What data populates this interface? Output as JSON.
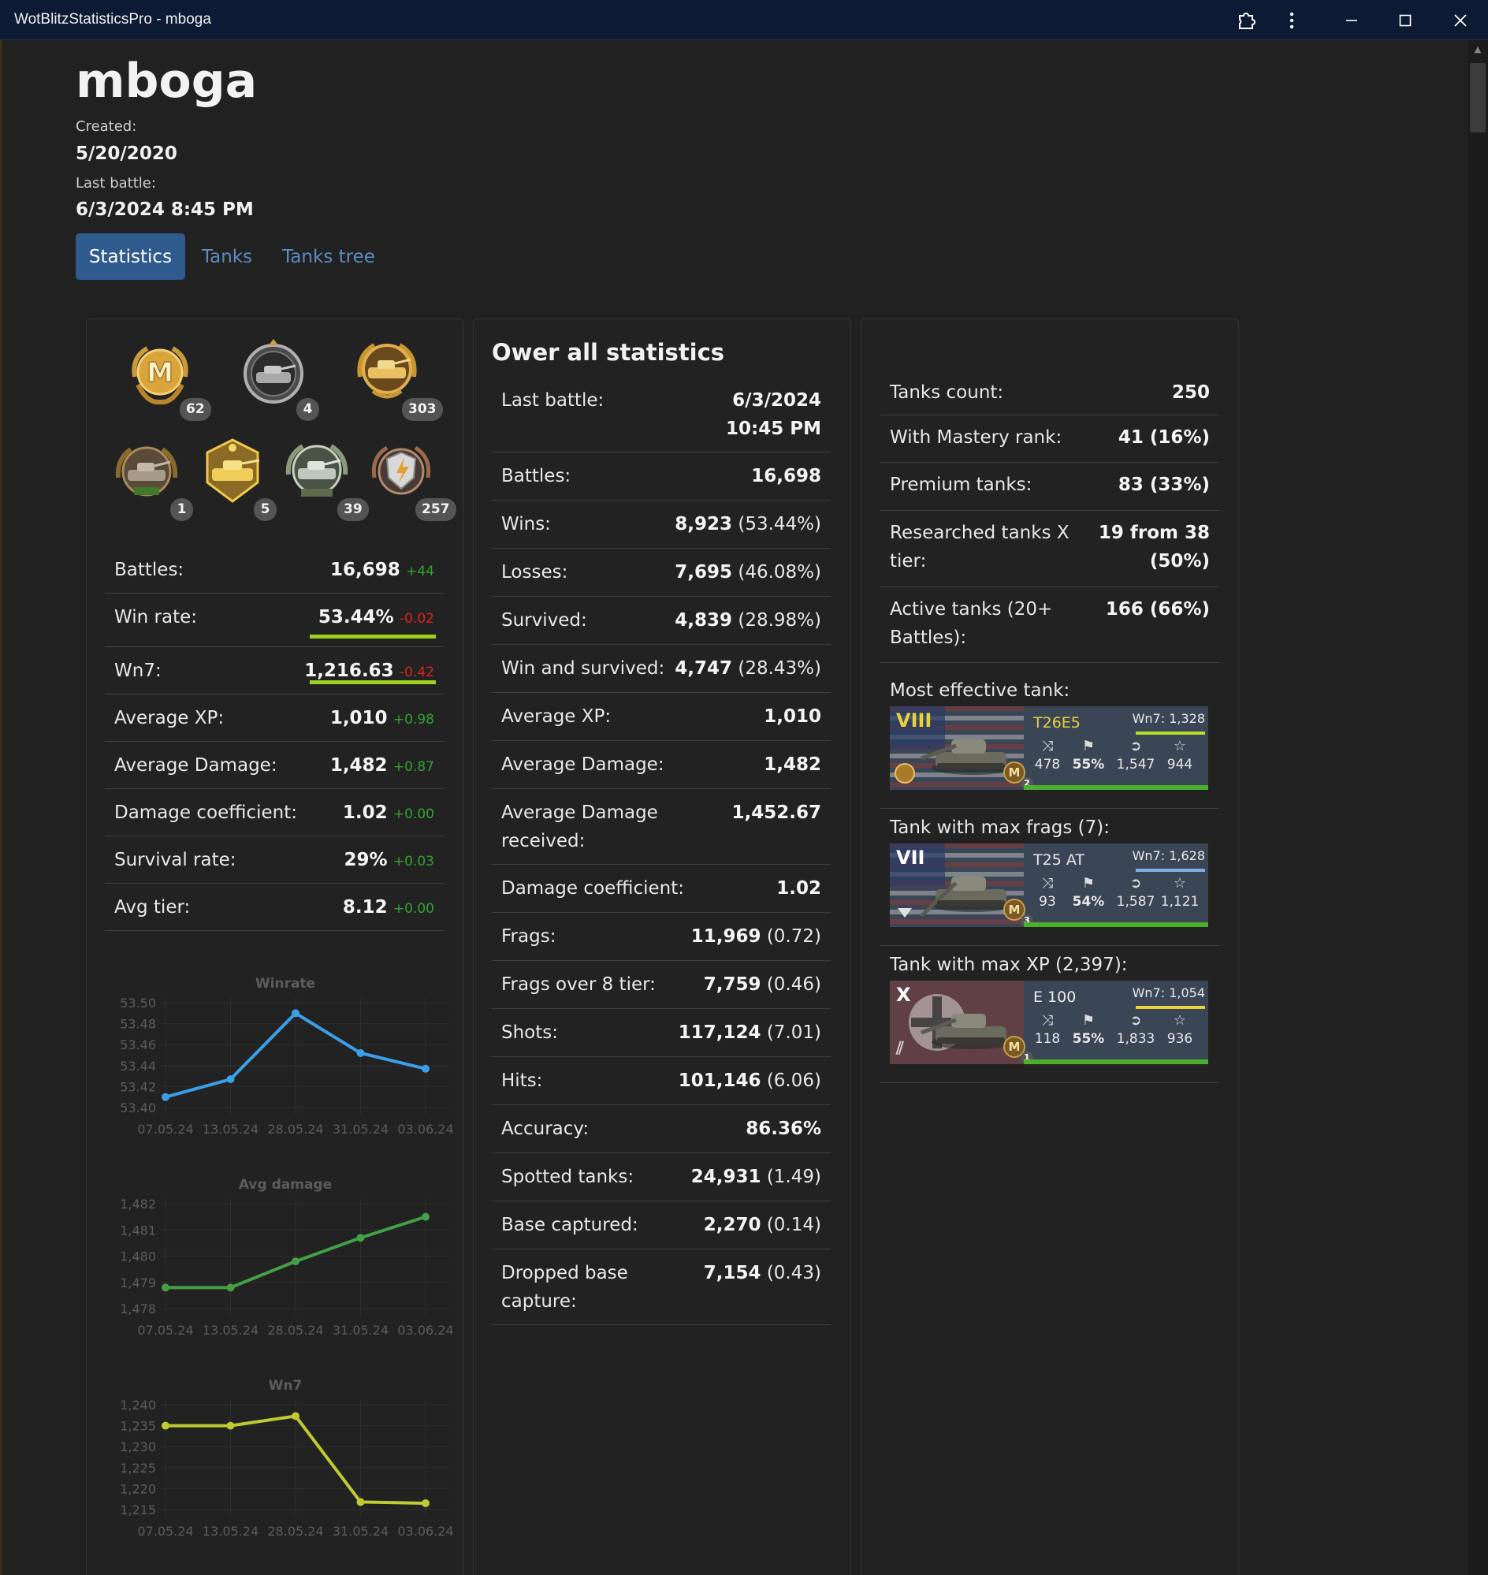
{
  "window": {
    "title": "WotBlitzStatisticsPro - mboga"
  },
  "player": {
    "name": "mboga",
    "created_label": "Created:",
    "created_value": "5/20/2020",
    "last_battle_label": "Last battle:",
    "last_battle_value": "6/3/2024 8:45 PM"
  },
  "tabs": [
    {
      "label": "Statistics",
      "active": true
    },
    {
      "label": "Tanks",
      "active": false
    },
    {
      "label": "Tanks tree",
      "active": false
    }
  ],
  "medals": [
    {
      "icon": "mastery-ace-icon",
      "count": "62"
    },
    {
      "icon": "tank-medal-icon",
      "count": "4"
    },
    {
      "icon": "gold-tank-medal-icon",
      "count": "303"
    },
    {
      "icon": "bronze-tank-medal-icon",
      "count": "1"
    },
    {
      "icon": "gold-tank-badge-icon",
      "count": "5"
    },
    {
      "icon": "silver-tank-badge-icon",
      "count": "39"
    },
    {
      "icon": "shield-lightning-medal-icon",
      "count": "257"
    }
  ],
  "left_stats": [
    {
      "label": "Battles:",
      "value": "16,698",
      "delta": "+44",
      "delta_sign": "pos"
    },
    {
      "label": "Win rate:",
      "value": "53.44%",
      "delta": "-0.02",
      "delta_sign": "neg",
      "underline": true
    },
    {
      "label": "Wn7:",
      "value": "1,216.63",
      "delta": "-0.42",
      "delta_sign": "neg",
      "underline": true
    },
    {
      "label": "Average XP:",
      "value": "1,010",
      "delta": "+0.98",
      "delta_sign": "pos"
    },
    {
      "label": "Average Damage:",
      "value": "1,482",
      "delta": "+0.87",
      "delta_sign": "pos"
    },
    {
      "label": "Damage coefficient:",
      "value": "1.02",
      "delta": "+0.00",
      "delta_sign": "pos"
    },
    {
      "label": "Survival rate:",
      "value": "29%",
      "delta": "+0.03",
      "delta_sign": "pos"
    },
    {
      "label": "Avg tier:",
      "value": "8.12",
      "delta": "+0.00",
      "delta_sign": "pos"
    }
  ],
  "overall": {
    "title": "Ower all statistics",
    "rows": [
      {
        "label": "Last battle:",
        "value": "6/3/2024",
        "value2": "10:45 PM",
        "extra": ""
      },
      {
        "label": "Battles:",
        "value": "16,698",
        "extra": ""
      },
      {
        "label": "Wins:",
        "value": "8,923",
        "extra": "(53.44%)"
      },
      {
        "label": "Losses:",
        "value": "7,695",
        "extra": "(46.08%)"
      },
      {
        "label": "Survived:",
        "value": "4,839",
        "extra": "(28.98%)"
      },
      {
        "label": "Win and survived:",
        "value": "4,747",
        "extra": "(28.43%)"
      },
      {
        "label": "Average XP:",
        "value": "1,010",
        "extra": ""
      },
      {
        "label": "Average Damage:",
        "value": "1,482",
        "extra": ""
      },
      {
        "label": "Average Damage",
        "label2": "received:",
        "value": "1,452.67",
        "extra": ""
      },
      {
        "label": "Damage coefficient:",
        "value": "1.02",
        "extra": ""
      },
      {
        "label": "Frags:",
        "value": "11,969",
        "extra": "(0.72)"
      },
      {
        "label": "Frags over 8 tier:",
        "value": "7,759",
        "extra": "(0.46)"
      },
      {
        "label": "Shots:",
        "value": "117,124",
        "extra": "(7.01)"
      },
      {
        "label": "Hits:",
        "value": "101,146",
        "extra": "(6.06)"
      },
      {
        "label": "Accuracy:",
        "value": "86.36%",
        "extra": ""
      },
      {
        "label": "Spotted tanks:",
        "value": "24,931",
        "extra": "(1.49)"
      },
      {
        "label": "Base captured:",
        "value": "2,270",
        "extra": "(0.14)"
      },
      {
        "label": "Dropped base",
        "label2": "capture:",
        "value": "7,154",
        "extra": "(0.43)"
      }
    ]
  },
  "summary": {
    "rows": [
      {
        "label": "Tanks count:",
        "value": "250"
      },
      {
        "label": "With Mastery rank:",
        "value": "41 (16%)"
      },
      {
        "label": "Premium tanks:",
        "value": "83 (33%)"
      },
      {
        "label": "Researched tanks X",
        "label2": "tier:",
        "value": "19 from 38",
        "value2": "(50%)"
      },
      {
        "label": "Active tanks (20+",
        "label2": "Battles):",
        "value": "166 (66%)"
      }
    ],
    "most_effective_label": "Most effective tank:",
    "max_frags_label": "Tank with max frags (7):",
    "max_xp_label": "Tank with max XP (2,397):"
  },
  "tanks": [
    {
      "tier": "VIII",
      "tier_color": "#e8d23a",
      "name": "T26E5",
      "name_color": "#e8d23a",
      "wn7": "Wn7: 1,328",
      "wn7_color": "#b8e02a",
      "frags": "478",
      "winrate": "55%",
      "damage": "1,547",
      "xp": "944",
      "mastery_count": "2",
      "flag": "usa",
      "premium": true
    },
    {
      "tier": "VII",
      "tier_color": "#ffffff",
      "name": "T25 AT",
      "name_color": "#eaeaea",
      "wn7": "Wn7: 1,628",
      "wn7_color": "#7fb0e0",
      "frags": "93",
      "winrate": "54%",
      "damage": "1,587",
      "xp": "1,121",
      "mastery_count": "3",
      "flag": "usa",
      "premium": false
    },
    {
      "tier": "X",
      "tier_color": "#ffffff",
      "name": "E 100",
      "name_color": "#eaeaea",
      "wn7": "Wn7: 1,054",
      "wn7_color": "#e8d23a",
      "frags": "118",
      "winrate": "55%",
      "damage": "1,833",
      "xp": "936",
      "mastery_count": "1",
      "flag": "germany",
      "premium": false
    }
  ],
  "charts_text": {
    "colors": {
      "winrate": "#3a9ee8",
      "avg_damage": "#43a047",
      "wn7": "#c0ca33"
    }
  },
  "chart_data": [
    {
      "type": "line",
      "title": "Winrate",
      "x": [
        "07.05.24",
        "13.05.24",
        "28.05.24",
        "31.05.24",
        "03.06.24"
      ],
      "values": [
        53.41,
        53.427,
        53.49,
        53.452,
        53.437
      ],
      "yticks": [
        "53.50",
        "53.48",
        "53.46",
        "53.44",
        "53.42",
        "53.40"
      ],
      "ylim": [
        53.4,
        53.5
      ],
      "color": "#3a9ee8"
    },
    {
      "type": "line",
      "title": "Avg damage",
      "x": [
        "07.05.24",
        "13.05.24",
        "28.05.24",
        "31.05.24",
        "03.06.24"
      ],
      "values": [
        1478.8,
        1478.8,
        1479.8,
        1480.7,
        1481.5
      ],
      "yticks": [
        "1,482",
        "1,481",
        "1,480",
        "1,479",
        "1,478"
      ],
      "ylim": [
        1478,
        1482
      ],
      "color": "#43a047"
    },
    {
      "type": "line",
      "title": "Wn7",
      "x": [
        "07.05.24",
        "13.05.24",
        "28.05.24",
        "31.05.24",
        "03.06.24"
      ],
      "values": [
        1235.0,
        1235.0,
        1237.3,
        1216.8,
        1216.5
      ],
      "yticks": [
        "1,240",
        "1,235",
        "1,230",
        "1,225",
        "1,220",
        "1,215"
      ],
      "ylim": [
        1215,
        1240
      ],
      "color": "#c0ca33"
    }
  ]
}
